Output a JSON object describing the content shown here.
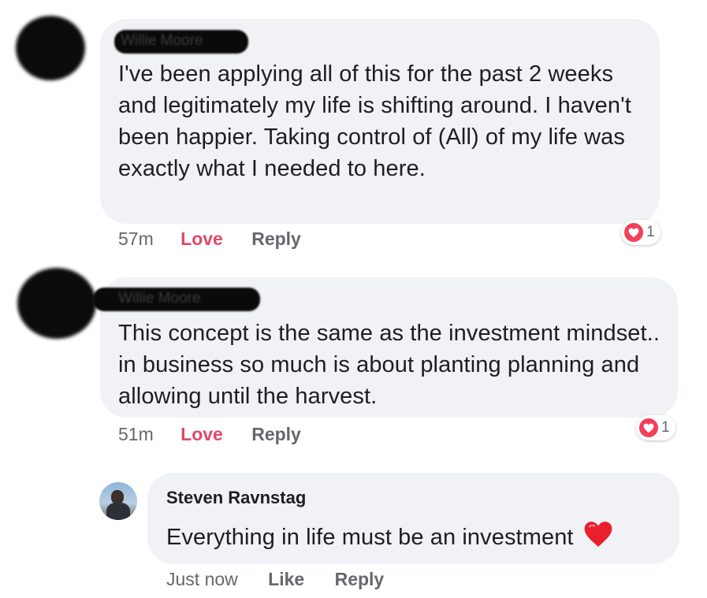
{
  "comments": [
    {
      "author": "Willie Moore",
      "text": "I've been applying all of this for the past 2 weeks and legitimately my life is shifting around. I haven't been happier. Taking control of (All) of my life was exactly what I needed to here.",
      "time": "57m",
      "love_label": "Love",
      "reply_label": "Reply",
      "reaction_count": "1"
    },
    {
      "author": "Willie Moore",
      "text": "This concept is the same as the investment mindset.. in business so much is about planting planning and allowing until the harvest.",
      "time": "51m",
      "love_label": "Love",
      "reply_label": "Reply",
      "reaction_count": "1"
    }
  ],
  "reply": {
    "author": "Steven Ravnstag",
    "text": "Everything in life must be an investment",
    "emoji": "❤️",
    "time": "Just now",
    "like_label": "Like",
    "reply_label": "Reply"
  },
  "colors": {
    "bubble": "#f0f2f5",
    "love": "#e0486a",
    "meta": "#65676b",
    "reaction_heart": "#f33e58"
  }
}
